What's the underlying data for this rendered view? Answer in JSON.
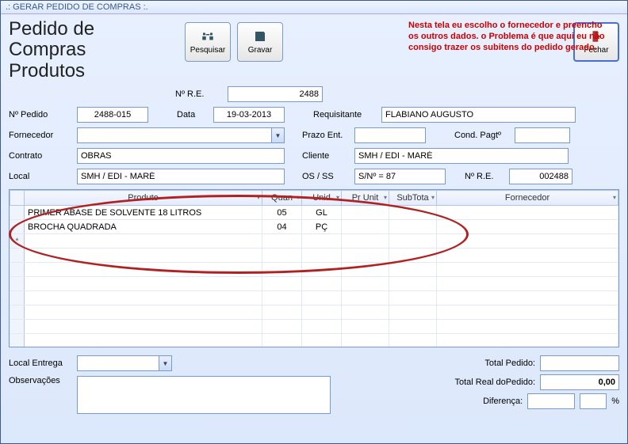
{
  "window": {
    "title": ".: GERAR PEDIDO DE COMPRAS :."
  },
  "heading": {
    "line1": "Pedido de Compras",
    "line2": "Produtos"
  },
  "toolbar": {
    "pesquisar": "Pesquisar",
    "gravar": "Gravar",
    "fechar": "Fechar"
  },
  "annotation": "Nesta tela eu escolho o fornecedor e preencho os outros dados. o Problema é que aqui eu não consigo trazer os subitens do pedido gerado.",
  "fields": {
    "n_re_label": "Nº R.E.",
    "n_re_value": "2488",
    "n_pedido_label": "Nº Pedido",
    "n_pedido_value": "2488-015",
    "data_label": "Data",
    "data_value": "19-03-2013",
    "requisitante_label": "Requisitante",
    "requisitante_value": "FLABIANO AUGUSTO",
    "fornecedor_label": "Fornecedor",
    "fornecedor_value": "",
    "prazo_label": "Prazo Ent.",
    "prazo_value": "",
    "cond_pag_label": "Cond. Pagtº",
    "cond_pag_value": "",
    "contrato_label": "Contrato",
    "contrato_value": "OBRAS",
    "cliente_label": "Cliente",
    "cliente_value": "SMH / EDI - MARÉ",
    "local_label": "Local",
    "local_value": "SMH / EDI - MARÉ",
    "os_ss_label": "OS / SS",
    "os_ss_value": "S/Nº = 87",
    "n_re2_label": "Nº R.E.",
    "n_re2_value": "002488"
  },
  "grid": {
    "columns": [
      "Produto",
      "Quan",
      "Unid",
      "Pr Unit",
      "SubTota",
      "Fornecedor"
    ],
    "rows": [
      {
        "produto": "PRIMER ABASE DE SOLVENTE 18 LITROS",
        "quant": "05",
        "unid": "GL",
        "pr_unit": "",
        "subtotal": "",
        "fornecedor": ""
      },
      {
        "produto": "BROCHA QUADRADA",
        "quant": "04",
        "unid": "PÇ",
        "pr_unit": "",
        "subtotal": "",
        "fornecedor": ""
      }
    ]
  },
  "footer": {
    "local_entrega_label": "Local Entrega",
    "local_entrega_value": "",
    "obs_label": "Observações",
    "obs_value": "",
    "total_pedido_label": "Total Pedido:",
    "total_pedido_value": "",
    "total_real_label": "Total Real doPedido:",
    "total_real_value": "0,00",
    "diferenca_label": "Diferença:",
    "diferenca_value": "",
    "diferenca_pct": "",
    "pct_symbol": "%"
  }
}
